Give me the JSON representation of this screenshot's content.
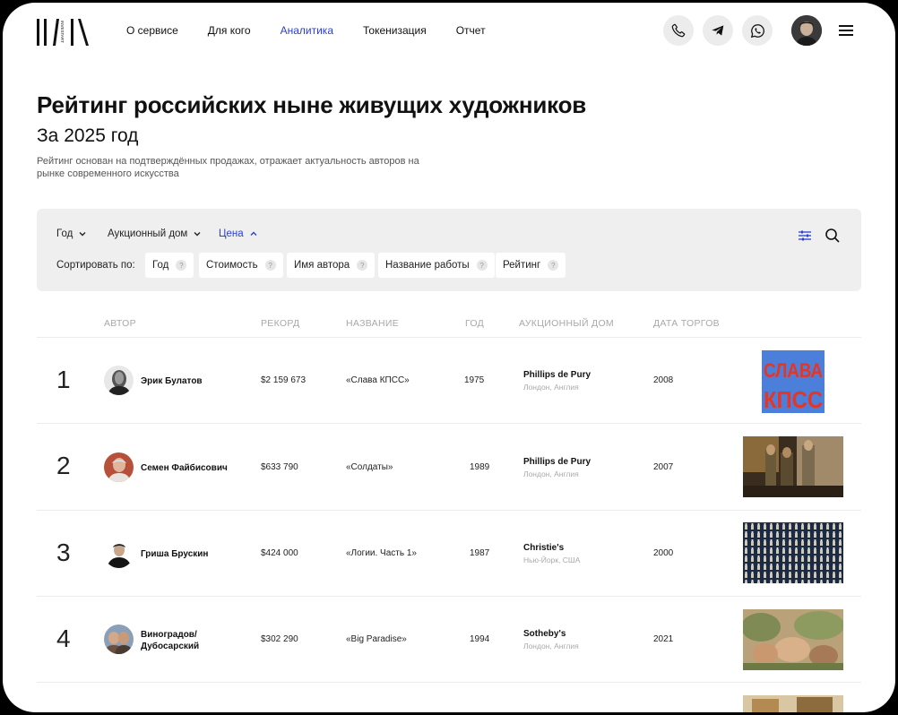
{
  "header": {
    "logo_text": "INVESTART",
    "nav": [
      {
        "label": "О сервисе",
        "active": false
      },
      {
        "label": "Для кого",
        "active": false
      },
      {
        "label": "Аналитика",
        "active": true
      },
      {
        "label": "Токенизация",
        "active": false
      },
      {
        "label": "Отчет",
        "active": false
      }
    ],
    "icons": [
      "phone-icon",
      "telegram-icon",
      "whatsapp-icon",
      "avatar",
      "menu-icon"
    ]
  },
  "page": {
    "title": "Рейтинг российских ныне живущих художников",
    "subtitle": "За 2025 год",
    "description": "Рейтинг основан на подтверждённых продажах, отражает актуальность авторов на рынке современного искусства"
  },
  "filters": {
    "dropdowns": [
      {
        "label": "Год",
        "expanded": false
      },
      {
        "label": "Аукционный дом",
        "expanded": false
      },
      {
        "label": "Цена",
        "expanded": true
      }
    ],
    "sort_label": "Сортировать по:",
    "sort_options": [
      "Год",
      "Стоимость",
      "Имя автора",
      "Название работы",
      "Рейтинг"
    ],
    "help_glyph": "?"
  },
  "table": {
    "columns": [
      "АВТОР",
      "РЕКОРД",
      "НАЗВАНИЕ",
      "ГОД",
      "АУКЦИОННЫЙ ДОМ",
      "ДАТА ТОРГОВ"
    ],
    "rows": [
      {
        "rank": "1",
        "author": "Эрик Булатов",
        "record": "$2 159 673",
        "title": "«Слава КПСС»",
        "year": "1975",
        "house": "Phillips de Pury",
        "city": "Лондон, Англия",
        "date": "2008",
        "artwork_text": [
          "СЛАВА",
          "КПСС"
        ]
      },
      {
        "rank": "2",
        "author": "Семен Файбисович",
        "record": "$633 790",
        "title": "«Солдаты»",
        "year": "1989",
        "house": "Phillips de Pury",
        "city": "Лондон, Англия",
        "date": "2007"
      },
      {
        "rank": "3",
        "author": "Гриша Брускин",
        "record": "$424 000",
        "title": "«Логии. Часть 1»",
        "year": "1987",
        "house": "Christie's",
        "city": "Нью-Йорк, США",
        "date": "2000"
      },
      {
        "rank": "4",
        "author": "Виноградов/ Дубосарский",
        "record": "$302 290",
        "title": "«Big Paradise»",
        "year": "1994",
        "house": "Sotheby's",
        "city": "Лондон, Англия",
        "date": "2021"
      }
    ]
  },
  "colors": {
    "accent": "#2a3fd6",
    "panel": "#efefef",
    "muted": "#a8a8a8"
  }
}
